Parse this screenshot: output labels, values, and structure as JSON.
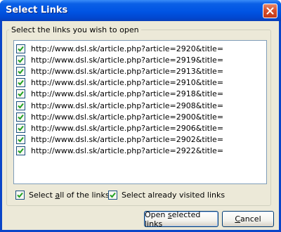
{
  "window": {
    "title": "Select Links"
  },
  "group": {
    "legend": "Select the links you wish to open"
  },
  "links": [
    {
      "url": "http://www.dsl.sk/article.php?article=2920&title=",
      "checked": true
    },
    {
      "url": "http://www.dsl.sk/article.php?article=2919&title=",
      "checked": true
    },
    {
      "url": "http://www.dsl.sk/article.php?article=2913&title=",
      "checked": true
    },
    {
      "url": "http://www.dsl.sk/article.php?article=2910&title=",
      "checked": true
    },
    {
      "url": "http://www.dsl.sk/article.php?article=2918&title=",
      "checked": true
    },
    {
      "url": "http://www.dsl.sk/article.php?article=2908&title=",
      "checked": true
    },
    {
      "url": "http://www.dsl.sk/article.php?article=2900&title=",
      "checked": true
    },
    {
      "url": "http://www.dsl.sk/article.php?article=2906&title=",
      "checked": true
    },
    {
      "url": "http://www.dsl.sk/article.php?article=2902&title=",
      "checked": true
    },
    {
      "url": "http://www.dsl.sk/article.php?article=2922&title=",
      "checked": true
    }
  ],
  "options": {
    "select_all_label_pre": "Select ",
    "select_all_label_accel": "a",
    "select_all_label_post": "ll of the links",
    "select_all_checked": true,
    "select_visited_label": "Select already visited links",
    "select_visited_checked": true
  },
  "buttons": {
    "open_pre": "Open ",
    "open_accel": "s",
    "open_post": "elected links",
    "cancel_pre": "",
    "cancel_accel": "C",
    "cancel_post": "ancel"
  },
  "colors": {
    "title_bar": "#0054e3",
    "close_button": "#d7502d",
    "check_mark": "#21a121",
    "dialog_bg": "#ece9d8",
    "list_border": "#7f9db9"
  },
  "icons": {
    "close": "close-icon",
    "check": "checkmark-icon"
  }
}
